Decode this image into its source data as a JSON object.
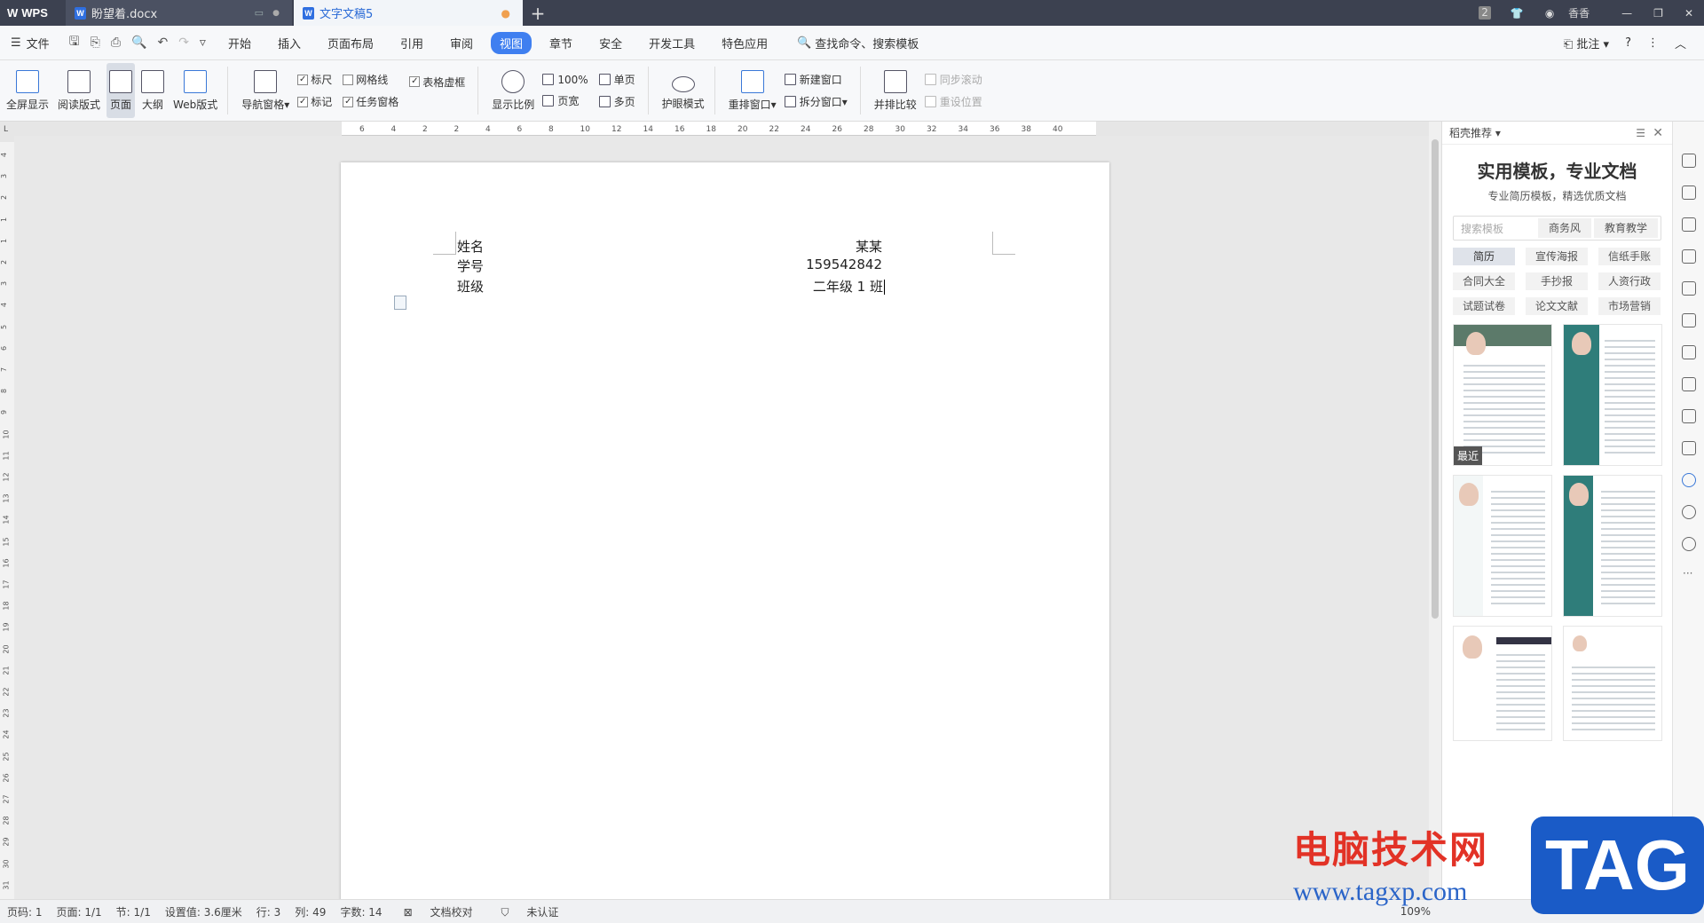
{
  "titlebar": {
    "app_name": "WPS",
    "tabs": [
      {
        "label": "盼望着.docx"
      },
      {
        "label": "文字文稿5"
      }
    ],
    "badge": "2",
    "user": "香香"
  },
  "menubar": {
    "file": "文件",
    "items": [
      "开始",
      "插入",
      "页面布局",
      "引用",
      "审阅",
      "视图",
      "章节",
      "安全",
      "开发工具",
      "特色应用"
    ],
    "active": "视图",
    "search": "查找命令、搜索模板",
    "annotate": "批注"
  },
  "ribbon": {
    "fullscreen": "全屏显示",
    "read_mode": "阅读版式",
    "page": "页面",
    "outline": "大纲",
    "web": "Web版式",
    "nav_pane": "导航窗格",
    "ruler": "标尺",
    "gridlines": "网格线",
    "table_dotted": "表格虚框",
    "markup": "标记",
    "task_pane": "任务窗格",
    "zoom": "显示比例",
    "zoom100": "100%",
    "page_width": "页宽",
    "single_page": "单页",
    "multi_page": "多页",
    "eye_mode": "护眼模式",
    "arrange": "重排窗口",
    "new_window": "新建窗口",
    "split_window": "拆分窗口",
    "side_by_side": "并排比较",
    "sync_scroll": "同步滚动",
    "reset_pos": "重设位置"
  },
  "ruler": {
    "h_ticks": [
      "6",
      "4",
      "2",
      "2",
      "4",
      "6",
      "8",
      "10",
      "12",
      "14",
      "16",
      "18",
      "20",
      "22",
      "24",
      "26",
      "28",
      "30",
      "32",
      "34",
      "36",
      "38",
      "40"
    ],
    "v_ticks": [
      "4",
      "3",
      "2",
      "1",
      "1",
      "2",
      "3",
      "4",
      "5",
      "6",
      "7",
      "8",
      "9",
      "10",
      "11",
      "12",
      "13",
      "14",
      "15",
      "16",
      "17",
      "18",
      "19",
      "20",
      "21",
      "22",
      "23",
      "24",
      "25",
      "26",
      "27",
      "28",
      "29",
      "30",
      "31"
    ]
  },
  "document": {
    "left": [
      "姓名",
      "学号",
      "班级"
    ],
    "right": [
      "某某",
      "159542842",
      "二年级 1 班"
    ]
  },
  "sidepanel": {
    "header": "稻壳推荐",
    "title": "实用模板，专业文档",
    "subtitle": "专业简历模板，精选优质文档",
    "search_placeholder": "搜索模板",
    "search_tags": [
      "商务风",
      "教育教学"
    ],
    "categories": [
      "简历",
      "宣传海报",
      "信纸手账",
      "合同大全",
      "手抄报",
      "人资行政",
      "试题试卷",
      "论文文献",
      "市场营销"
    ],
    "recent_label": "最近"
  },
  "statusbar": {
    "page_no": "页码: 1",
    "pages": "页面: 1/1",
    "section": "节: 1/1",
    "setting": "设置值: 3.6厘米",
    "row": "行: 3",
    "col": "列: 49",
    "words": "字数: 14",
    "proof": "文档校对",
    "cert": "未认证",
    "zoom": "109%"
  },
  "watermark": {
    "site_cn": "电脑技术网",
    "site_url": "www.tagxp.com",
    "tag": "TAG"
  },
  "colors": {
    "titlebar": "#3c4150",
    "accent": "#3f7ff0",
    "teal_template": "#2f7d7a"
  }
}
